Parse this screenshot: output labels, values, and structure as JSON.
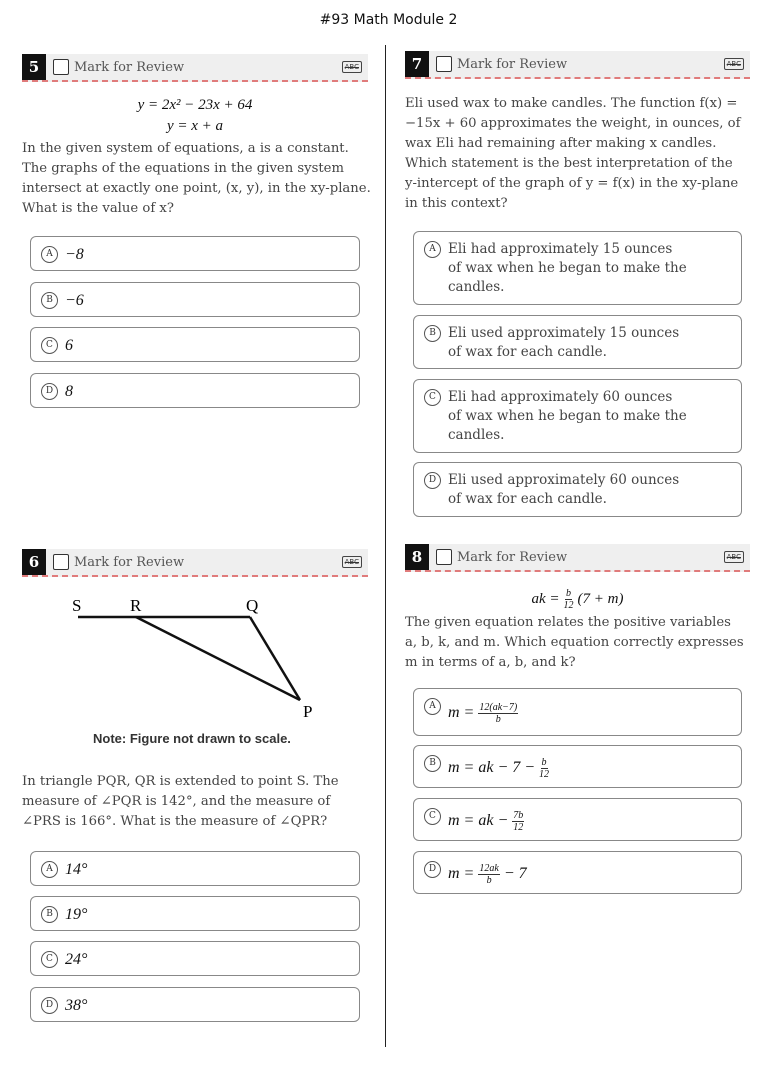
{
  "title": "#93 Math Module 2",
  "mark_label": "Mark for Review",
  "abc_label": "ABC",
  "q5": {
    "number": "5",
    "eq1": "y = 2x² − 23x + 64",
    "eq2": "y = x + a",
    "text": "In the given system of equations, a is a constant. The graphs of the equations in the given system intersect at exactly one point, (x, y), in the xy-plane. What is the value of x?",
    "options": [
      {
        "letter": "A",
        "text": "−8"
      },
      {
        "letter": "B",
        "text": "−6"
      },
      {
        "letter": "C",
        "text": "6"
      },
      {
        "letter": "D",
        "text": "8"
      }
    ]
  },
  "q6": {
    "number": "6",
    "labels": {
      "S": "S",
      "R": "R",
      "Q": "Q",
      "P": "P"
    },
    "note": "Note: Figure not drawn to scale.",
    "text": "In triangle PQR, QR is extended to point S. The measure of ∠PQR is 142°, and the measure of ∠PRS is 166°. What is the measure of ∠QPR?",
    "options": [
      {
        "letter": "A",
        "text": "14°"
      },
      {
        "letter": "B",
        "text": "19°"
      },
      {
        "letter": "C",
        "text": "24°"
      },
      {
        "letter": "D",
        "text": "38°"
      }
    ]
  },
  "q7": {
    "number": "7",
    "text": "Eli used wax to make candles. The function f(x) = −15x + 60 approximates the weight, in ounces, of wax Eli had remaining after making x candles. Which statement is the best interpretation of the y-intercept of the graph of y = f(x) in the xy-plane in this context?",
    "options": [
      {
        "letter": "A",
        "text": "Eli had approximately 15 ounces of wax when he began to make the candles."
      },
      {
        "letter": "B",
        "text": "Eli used approximately 15 ounces of wax for each candle."
      },
      {
        "letter": "C",
        "text": "Eli had approximately 60 ounces of wax when he began to make the candles."
      },
      {
        "letter": "D",
        "text": "Eli used approximately 60 ounces of wax for each candle."
      }
    ]
  },
  "q8": {
    "number": "8",
    "eq_left": "ak =",
    "eq_num": "b",
    "eq_den": "12",
    "eq_right": "(7 + m)",
    "text": "The given equation relates the positive variables a, b, k, and m. Which equation correctly expresses m in terms of a, b, and k?",
    "options": [
      {
        "letter": "A",
        "pre": "m =",
        "num": "12(ak−7)",
        "den": "b",
        "post": ""
      },
      {
        "letter": "B",
        "pre": "m = ak − 7 −",
        "num": "b",
        "den": "12",
        "post": ""
      },
      {
        "letter": "C",
        "pre": "m = ak −",
        "num": "7b",
        "den": "12",
        "post": ""
      },
      {
        "letter": "D",
        "pre": "m =",
        "num": "12ak",
        "den": "b",
        "post": "− 7"
      }
    ]
  }
}
